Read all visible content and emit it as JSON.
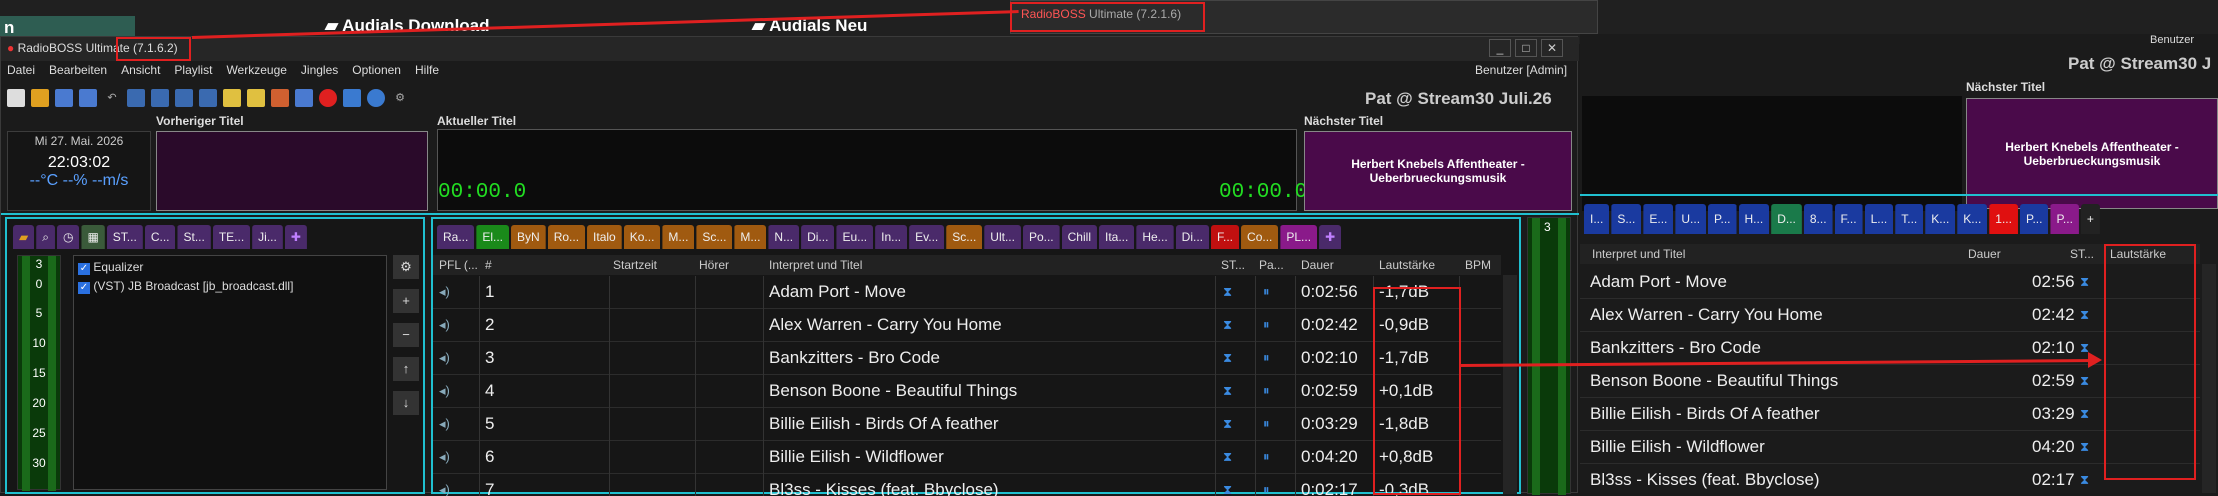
{
  "bg_tabs": {
    "tab1": "n",
    "tab2": "Audials Download",
    "tab3": "Audials Neu"
  },
  "ghost_title": {
    "app": "RadioBOSS",
    "edition": "Ultimate (7.2.1.6)"
  },
  "window": {
    "title": "RadioBOSS Ultimate (7.1.6.2)",
    "user": "Benutzer [Admin]",
    "station": "Pat @ Stream30 Juli.26"
  },
  "menu": [
    "Datei",
    "Bearbeiten",
    "Ansicht",
    "Playlist",
    "Werkzeuge",
    "Jingles",
    "Optionen",
    "Hilfe"
  ],
  "clock": {
    "date": "Mi 27. Mai. 2026",
    "time": "22:03:02",
    "weather": "--°C --% --m/s"
  },
  "prev": {
    "label": "Vorheriger Titel"
  },
  "current": {
    "label": "Aktueller Titel",
    "elapsed": "00:00.0",
    "remaining": "00:00.0"
  },
  "next": {
    "label": "Nächster Titel",
    "title": "Herbert Knebels Affentheater - Ueberbrueckungsmusik"
  },
  "left_tabs": [
    "Ra...",
    "ST...",
    "C...",
    "St...",
    "TE...",
    "Ji..."
  ],
  "effects": {
    "items": [
      "Equalizer",
      "(VST) JB Broadcast [jb_broadcast.dll]"
    ],
    "meter_ticks": [
      "3",
      "0",
      "5",
      "10",
      "15",
      "20",
      "25",
      "30"
    ]
  },
  "playlist_tabs": [
    "Ra...",
    "El...",
    "ByN",
    "Ro...",
    "Italo",
    "Ko...",
    "M...",
    "Sc...",
    "M...",
    "N...",
    "Di...",
    "Eu...",
    "In...",
    "Ev...",
    "Sc...",
    "Ult...",
    "Po...",
    "Chill",
    "Ita...",
    "He...",
    "Di...",
    "F...",
    "Co...",
    "PL..."
  ],
  "columns": {
    "pfl": "PFL (...",
    "num": "#",
    "start": "Startzeit",
    "listeners": "Hörer",
    "artist": "Interpret und Titel",
    "st": "ST...",
    "pa": "Pa...",
    "duration": "Dauer",
    "loudness": "Lautstärke",
    "bpm": "BPM"
  },
  "rows": [
    {
      "n": "1",
      "title": "Adam Port - Move",
      "dur": "0:02:56",
      "dur2": "02:56",
      "loud": "-1,7dB"
    },
    {
      "n": "2",
      "title": "Alex Warren - Carry You Home",
      "dur": "0:02:42",
      "dur2": "02:42",
      "loud": "-0,9dB"
    },
    {
      "n": "3",
      "title": "Bankzitters - Bro Code",
      "dur": "0:02:10",
      "dur2": "02:10",
      "loud": "-1,7dB"
    },
    {
      "n": "4",
      "title": "Benson Boone - Beautiful Things",
      "dur": "0:02:59",
      "dur2": "02:59",
      "loud": "+0,1dB"
    },
    {
      "n": "5",
      "title": "Billie Eilish - Birds Of A feather",
      "dur": "0:03:29",
      "dur2": "03:29",
      "loud": "-1,8dB"
    },
    {
      "n": "6",
      "title": "Billie Eilish - Wildflower",
      "dur": "0:04:20",
      "dur2": "04:20",
      "loud": "+0,8dB"
    },
    {
      "n": "7",
      "title": "Bl3ss - Kisses (feat. Bbyclose)",
      "dur": "0:02:17",
      "dur2": "02:17",
      "loud": "-0,3dB"
    }
  ],
  "right": {
    "user": "Benutzer",
    "station": "Pat @ Stream30 J",
    "next_label": "Nächster Titel",
    "next_title": "Herbert Knebels Affentheater - Ueberbrueckungsmusik",
    "col_title": "Interpret und Titel",
    "col_dur": "Dauer",
    "col_st": "ST...",
    "col_loud": "Lautstärke",
    "tabs": [
      "I...",
      "S...",
      "E...",
      "U...",
      "P...",
      "H...",
      "D...",
      "8...",
      "F...",
      "L...",
      "T...",
      "K...",
      "K...",
      "1...",
      "P...",
      "P...",
      "+"
    ]
  },
  "colors": {
    "accent_red": "#e02020",
    "purple": "#4a0a4a",
    "green": "#22dd22"
  }
}
